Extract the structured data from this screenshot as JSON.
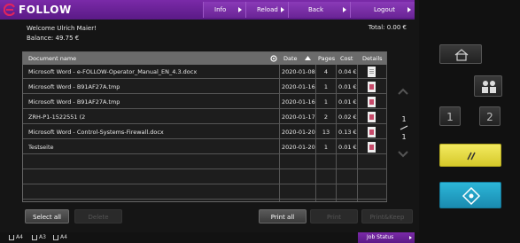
{
  "app": {
    "logo_text": "FOLLOW"
  },
  "nav": [
    {
      "label": "Info"
    },
    {
      "label": "Reload"
    },
    {
      "label": "Back"
    },
    {
      "label": "Logout"
    }
  ],
  "user": {
    "welcome": "Welcome Ulrich Maier!",
    "balance": "Balance: 49.75 €"
  },
  "total": "Total: 0.00 €",
  "table": {
    "columns": {
      "name": "Document name",
      "date": "Date",
      "pages": "Pages",
      "cost": "Cost",
      "details": "Details"
    },
    "rows": [
      {
        "name": "Microsoft Word - e-FOLLOW-Operator_Manual_EN_4.3.docx",
        "date": "2020-01-08",
        "pages": "4",
        "cost": "0.04 €",
        "icon": "plain"
      },
      {
        "name": "Microsoft Word - B91AF27A.tmp",
        "date": "2020-01-16",
        "pages": "1",
        "cost": "0.01 €",
        "icon": "word"
      },
      {
        "name": "Microsoft Word - B91AF27A.tmp",
        "date": "2020-01-16",
        "pages": "1",
        "cost": "0.01 €",
        "icon": "word"
      },
      {
        "name": "ZRH-P1-1522551 (2",
        "date": "2020-01-17",
        "pages": "2",
        "cost": "0.02 €",
        "icon": "word"
      },
      {
        "name": "Microsoft Word - Control-Systems-Firewall.docx",
        "date": "2020-01-20",
        "pages": "13",
        "cost": "0.13 €",
        "icon": "word"
      },
      {
        "name": "Testseite",
        "date": "2020-01-20",
        "pages": "1",
        "cost": "0.01 €",
        "icon": "word"
      }
    ]
  },
  "pagination": {
    "current": "1",
    "total": "1"
  },
  "actions": {
    "select_all": "Select all",
    "delete": "Delete",
    "print_all": "Print all",
    "print": "Print",
    "print_keep": "Print&Keep"
  },
  "footer": {
    "paper": [
      "A4",
      "A3",
      "A4"
    ],
    "job_status": "Job Status"
  },
  "keypad": {
    "key1": "1",
    "key2": "2"
  },
  "colors": {
    "brand": "#6a2596",
    "accent_yellow": "#e8dc40",
    "accent_cyan": "#22a0c8"
  },
  "icons": [
    "home-icon",
    "users-icon",
    "clear-icon",
    "start-icon",
    "gear-icon",
    "word-document-icon",
    "text-document-icon"
  ]
}
